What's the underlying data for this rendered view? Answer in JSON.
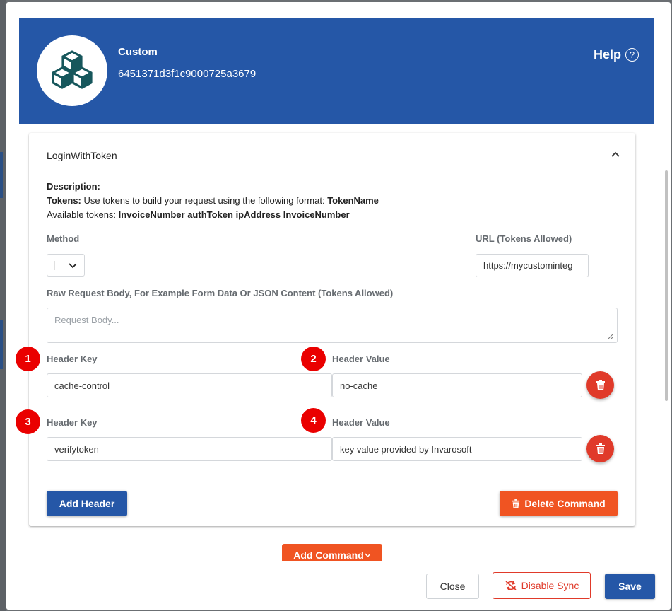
{
  "header": {
    "app_name": "Custom",
    "app_id": "6451371d3f1c9000725a3679",
    "help_label": "Help",
    "help_icon_glyph": "?"
  },
  "command": {
    "title": "LoginWithToken",
    "description_label": "Description:",
    "tokens_label": "Tokens:",
    "tokens_text": " Use tokens to build your request using the following format: ",
    "token_format": "TokenName",
    "available_label": "Available tokens: ",
    "available_tokens": "InvoiceNumber authToken ipAddress InvoiceNumber",
    "method_label": "Method",
    "method_value": "",
    "url_label": "URL (Tokens Allowed)",
    "url_value": "https://mycustominteg",
    "body_label": "Raw Request Body, For Example Form Data Or JSON Content (Tokens Allowed)",
    "body_placeholder": "Request Body...",
    "headers": [
      {
        "key_label": "Header Key",
        "key_value": "cache-control",
        "value_label": "Header Value",
        "value_value": "no-cache"
      },
      {
        "key_label": "Header Key",
        "key_value": "verifytoken",
        "value_label": "Header Value",
        "value_value": "key value provided by Invarosoft"
      }
    ],
    "add_header_label": "Add Header",
    "delete_command_label": "Delete Command"
  },
  "badges": [
    "1",
    "2",
    "3",
    "4"
  ],
  "add_command_label": "Add Command",
  "footer": {
    "close_label": "Close",
    "disable_sync_label": "Disable Sync",
    "save_label": "Save"
  },
  "colors": {
    "brand_blue": "#2557a7",
    "accent_orange": "#f05422",
    "danger_red": "#e03a2a",
    "badge_red": "#ea0000"
  }
}
